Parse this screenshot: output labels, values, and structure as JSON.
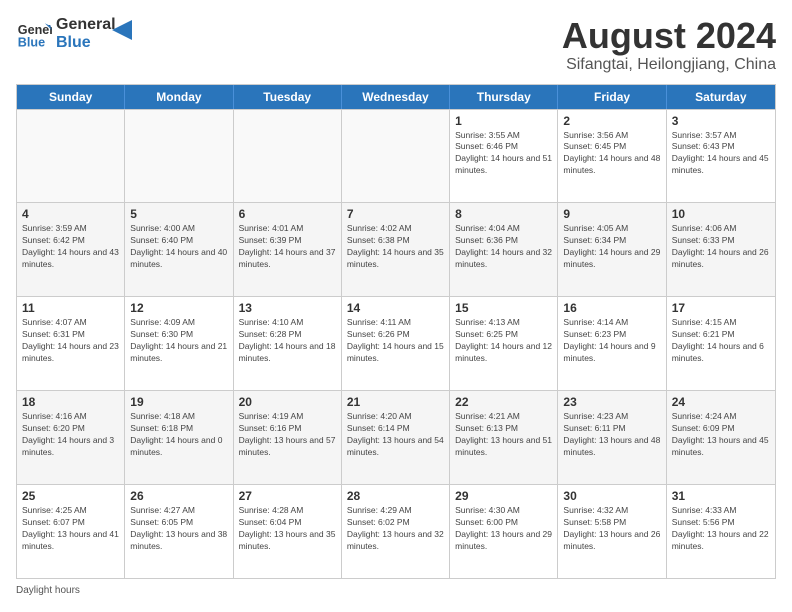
{
  "header": {
    "logo_line1": "General",
    "logo_line2": "Blue",
    "main_title": "August 2024",
    "subtitle": "Sifangtai, Heilongjiang, China"
  },
  "weekdays": [
    "Sunday",
    "Monday",
    "Tuesday",
    "Wednesday",
    "Thursday",
    "Friday",
    "Saturday"
  ],
  "footer_label": "Daylight hours",
  "weeks": [
    [
      {
        "day": "",
        "empty": true
      },
      {
        "day": "",
        "empty": true
      },
      {
        "day": "",
        "empty": true
      },
      {
        "day": "",
        "empty": true
      },
      {
        "day": "1",
        "sunrise": "Sunrise: 3:55 AM",
        "sunset": "Sunset: 6:46 PM",
        "daylight": "Daylight: 14 hours and 51 minutes."
      },
      {
        "day": "2",
        "sunrise": "Sunrise: 3:56 AM",
        "sunset": "Sunset: 6:45 PM",
        "daylight": "Daylight: 14 hours and 48 minutes."
      },
      {
        "day": "3",
        "sunrise": "Sunrise: 3:57 AM",
        "sunset": "Sunset: 6:43 PM",
        "daylight": "Daylight: 14 hours and 45 minutes."
      }
    ],
    [
      {
        "day": "4",
        "sunrise": "Sunrise: 3:59 AM",
        "sunset": "Sunset: 6:42 PM",
        "daylight": "Daylight: 14 hours and 43 minutes."
      },
      {
        "day": "5",
        "sunrise": "Sunrise: 4:00 AM",
        "sunset": "Sunset: 6:40 PM",
        "daylight": "Daylight: 14 hours and 40 minutes."
      },
      {
        "day": "6",
        "sunrise": "Sunrise: 4:01 AM",
        "sunset": "Sunset: 6:39 PM",
        "daylight": "Daylight: 14 hours and 37 minutes."
      },
      {
        "day": "7",
        "sunrise": "Sunrise: 4:02 AM",
        "sunset": "Sunset: 6:38 PM",
        "daylight": "Daylight: 14 hours and 35 minutes."
      },
      {
        "day": "8",
        "sunrise": "Sunrise: 4:04 AM",
        "sunset": "Sunset: 6:36 PM",
        "daylight": "Daylight: 14 hours and 32 minutes."
      },
      {
        "day": "9",
        "sunrise": "Sunrise: 4:05 AM",
        "sunset": "Sunset: 6:34 PM",
        "daylight": "Daylight: 14 hours and 29 minutes."
      },
      {
        "day": "10",
        "sunrise": "Sunrise: 4:06 AM",
        "sunset": "Sunset: 6:33 PM",
        "daylight": "Daylight: 14 hours and 26 minutes."
      }
    ],
    [
      {
        "day": "11",
        "sunrise": "Sunrise: 4:07 AM",
        "sunset": "Sunset: 6:31 PM",
        "daylight": "Daylight: 14 hours and 23 minutes."
      },
      {
        "day": "12",
        "sunrise": "Sunrise: 4:09 AM",
        "sunset": "Sunset: 6:30 PM",
        "daylight": "Daylight: 14 hours and 21 minutes."
      },
      {
        "day": "13",
        "sunrise": "Sunrise: 4:10 AM",
        "sunset": "Sunset: 6:28 PM",
        "daylight": "Daylight: 14 hours and 18 minutes."
      },
      {
        "day": "14",
        "sunrise": "Sunrise: 4:11 AM",
        "sunset": "Sunset: 6:26 PM",
        "daylight": "Daylight: 14 hours and 15 minutes."
      },
      {
        "day": "15",
        "sunrise": "Sunrise: 4:13 AM",
        "sunset": "Sunset: 6:25 PM",
        "daylight": "Daylight: 14 hours and 12 minutes."
      },
      {
        "day": "16",
        "sunrise": "Sunrise: 4:14 AM",
        "sunset": "Sunset: 6:23 PM",
        "daylight": "Daylight: 14 hours and 9 minutes."
      },
      {
        "day": "17",
        "sunrise": "Sunrise: 4:15 AM",
        "sunset": "Sunset: 6:21 PM",
        "daylight": "Daylight: 14 hours and 6 minutes."
      }
    ],
    [
      {
        "day": "18",
        "sunrise": "Sunrise: 4:16 AM",
        "sunset": "Sunset: 6:20 PM",
        "daylight": "Daylight: 14 hours and 3 minutes."
      },
      {
        "day": "19",
        "sunrise": "Sunrise: 4:18 AM",
        "sunset": "Sunset: 6:18 PM",
        "daylight": "Daylight: 14 hours and 0 minutes."
      },
      {
        "day": "20",
        "sunrise": "Sunrise: 4:19 AM",
        "sunset": "Sunset: 6:16 PM",
        "daylight": "Daylight: 13 hours and 57 minutes."
      },
      {
        "day": "21",
        "sunrise": "Sunrise: 4:20 AM",
        "sunset": "Sunset: 6:14 PM",
        "daylight": "Daylight: 13 hours and 54 minutes."
      },
      {
        "day": "22",
        "sunrise": "Sunrise: 4:21 AM",
        "sunset": "Sunset: 6:13 PM",
        "daylight": "Daylight: 13 hours and 51 minutes."
      },
      {
        "day": "23",
        "sunrise": "Sunrise: 4:23 AM",
        "sunset": "Sunset: 6:11 PM",
        "daylight": "Daylight: 13 hours and 48 minutes."
      },
      {
        "day": "24",
        "sunrise": "Sunrise: 4:24 AM",
        "sunset": "Sunset: 6:09 PM",
        "daylight": "Daylight: 13 hours and 45 minutes."
      }
    ],
    [
      {
        "day": "25",
        "sunrise": "Sunrise: 4:25 AM",
        "sunset": "Sunset: 6:07 PM",
        "daylight": "Daylight: 13 hours and 41 minutes."
      },
      {
        "day": "26",
        "sunrise": "Sunrise: 4:27 AM",
        "sunset": "Sunset: 6:05 PM",
        "daylight": "Daylight: 13 hours and 38 minutes."
      },
      {
        "day": "27",
        "sunrise": "Sunrise: 4:28 AM",
        "sunset": "Sunset: 6:04 PM",
        "daylight": "Daylight: 13 hours and 35 minutes."
      },
      {
        "day": "28",
        "sunrise": "Sunrise: 4:29 AM",
        "sunset": "Sunset: 6:02 PM",
        "daylight": "Daylight: 13 hours and 32 minutes."
      },
      {
        "day": "29",
        "sunrise": "Sunrise: 4:30 AM",
        "sunset": "Sunset: 6:00 PM",
        "daylight": "Daylight: 13 hours and 29 minutes."
      },
      {
        "day": "30",
        "sunrise": "Sunrise: 4:32 AM",
        "sunset": "Sunset: 5:58 PM",
        "daylight": "Daylight: 13 hours and 26 minutes."
      },
      {
        "day": "31",
        "sunrise": "Sunrise: 4:33 AM",
        "sunset": "Sunset: 5:56 PM",
        "daylight": "Daylight: 13 hours and 22 minutes."
      }
    ]
  ]
}
